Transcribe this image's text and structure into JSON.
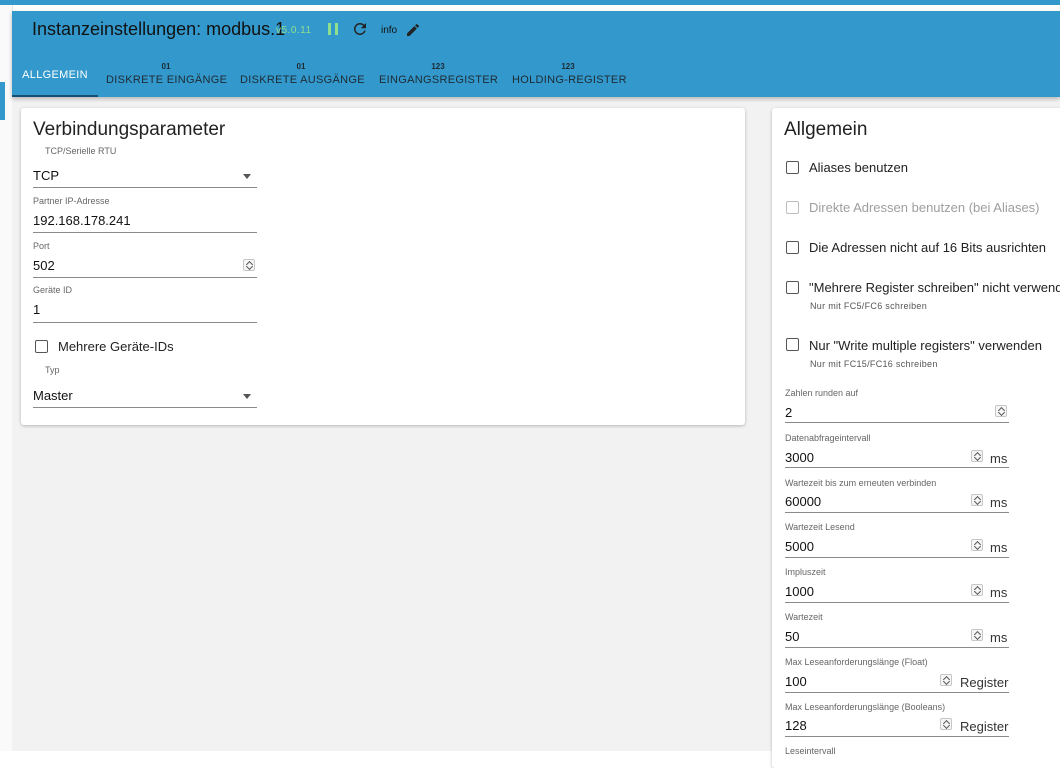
{
  "header": {
    "title": "Instanzeinstellungen: modbus.1",
    "version": "v5.0.11",
    "info_label": "info",
    "icons": [
      "pause-icon",
      "reload-icon",
      "edit-icon"
    ],
    "accent_color": "#3399cc"
  },
  "tabs": [
    {
      "label": "ALLGEMEIN",
      "badge": "",
      "active": true
    },
    {
      "label": "DISKRETE EINGÄNGE",
      "badge": "01",
      "active": false
    },
    {
      "label": "DISKRETE AUSGÄNGE",
      "badge": "01",
      "active": false
    },
    {
      "label": "EINGANGSREGISTER",
      "badge": "123",
      "active": false
    },
    {
      "label": "HOLDING-REGISTER",
      "badge": "123",
      "active": false
    }
  ],
  "connection": {
    "title": "Verbindungsparameter",
    "type": {
      "label": "TCP/Serielle RTU",
      "value": "TCP"
    },
    "ip": {
      "label": "Partner IP-Adresse",
      "value": "192.168.178.241"
    },
    "port": {
      "label": "Port",
      "value": "502"
    },
    "device_id": {
      "label": "Geräte ID",
      "value": "1"
    },
    "multi_ids": {
      "label": "Mehrere Geräte-IDs",
      "checked": false
    },
    "mode": {
      "label": "Typ",
      "value": "Master"
    }
  },
  "general": {
    "title": "Allgemein",
    "checkboxes": [
      {
        "label": "Aliases benutzen",
        "checked": false,
        "disabled": false,
        "help": ""
      },
      {
        "label": "Direkte Adressen benutzen (bei Aliases)",
        "checked": false,
        "disabled": true,
        "help": ""
      },
      {
        "label": "Die Adressen nicht auf 16 Bits ausrichten",
        "checked": false,
        "disabled": false,
        "help": ""
      },
      {
        "label": "\"Mehrere Register schreiben\" nicht verwenden",
        "checked": false,
        "disabled": false,
        "help": "Nur mit FC5/FC6 schreiben"
      },
      {
        "label": "Nur \"Write multiple registers\" verwenden",
        "checked": false,
        "disabled": false,
        "help": "Nur mit FC15/FC16 schreiben"
      }
    ],
    "fields": [
      {
        "label": "Zahlen runden auf",
        "value": "2",
        "unit": ""
      },
      {
        "label": "Datenabfrageintervall",
        "value": "3000",
        "unit": "ms"
      },
      {
        "label": "Wartezeit bis zum erneuten verbinden",
        "value": "60000",
        "unit": "ms"
      },
      {
        "label": "Wartezeit Lesend",
        "value": "5000",
        "unit": "ms"
      },
      {
        "label": "Impluszeit",
        "value": "1000",
        "unit": "ms"
      },
      {
        "label": "Wartezeit",
        "value": "50",
        "unit": "ms"
      },
      {
        "label": "Max Leseanforderungslänge (Float)",
        "value": "100",
        "unit": "Register"
      },
      {
        "label": "Max Leseanforderungslänge (Booleans)",
        "value": "128",
        "unit": "Register"
      },
      {
        "label": "Leseintervall",
        "value": "",
        "unit": ""
      }
    ]
  }
}
